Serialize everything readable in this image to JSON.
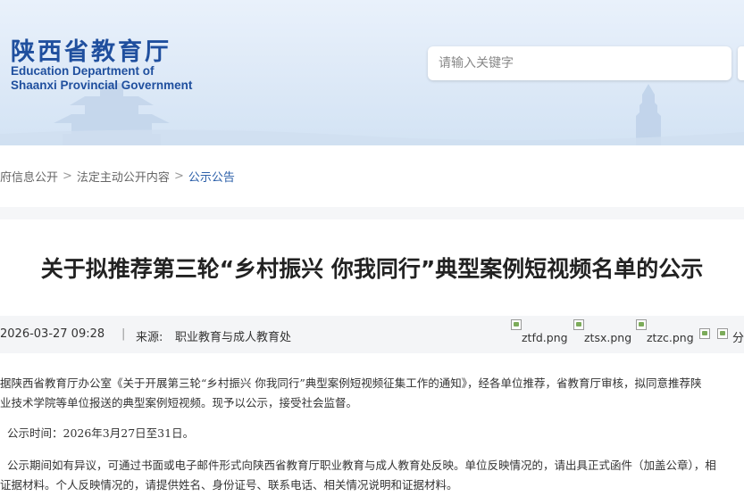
{
  "header": {
    "logo_cn": "陕西省教育厅",
    "logo_en_line1": "Education Department of",
    "logo_en_line2": "Shaanxi Provincial Government",
    "search_placeholder": "请输入关键字"
  },
  "breadcrumb": [
    "府信息公开",
    "法定主动公开内容",
    "公示公告"
  ],
  "breadcrumb_sep": ">",
  "article": {
    "title": "关于拟推荐第三轮“乡村振兴 你我同行”典型案例短视频名单的公示",
    "date": "2026-03-27 09:28",
    "divider": "|",
    "source_label": "来源:",
    "source": "职业教育与成人教育处",
    "share_files": [
      "ztfd.png",
      "ztsx.png",
      "ztzc.png"
    ],
    "share_label": "分",
    "paragraphs": {
      "p1_line1": "据陕西省教育厅办公室《关于开展第三轮“乡村振兴 你我同行”典型案例短视频征集工作的通知》，经各单位推荐，省教育厅审核，拟同意推荐陕",
      "p1_line2": "业技术学院等单位报送的典型案例短视频。现予以公示，接受社会监督。",
      "p2": "公示时间：2026年3月27日至31日。",
      "p3_line1": "公示期间如有异议，可通过书面或电子邮件形式向陕西省教育厅职业教育与成人教育处反映。单位反映情况的，请出具正式函件（加盖公章），相",
      "p3_line2": "证据材料。个人反映情况的，请提供姓名、身份证号、联系电话、相关情况说明和证据材料。"
    }
  },
  "colors": {
    "brand_blue": "#1f4f9e",
    "header_bg": "#dde9f7",
    "meta_bg": "#f4f5f7"
  }
}
